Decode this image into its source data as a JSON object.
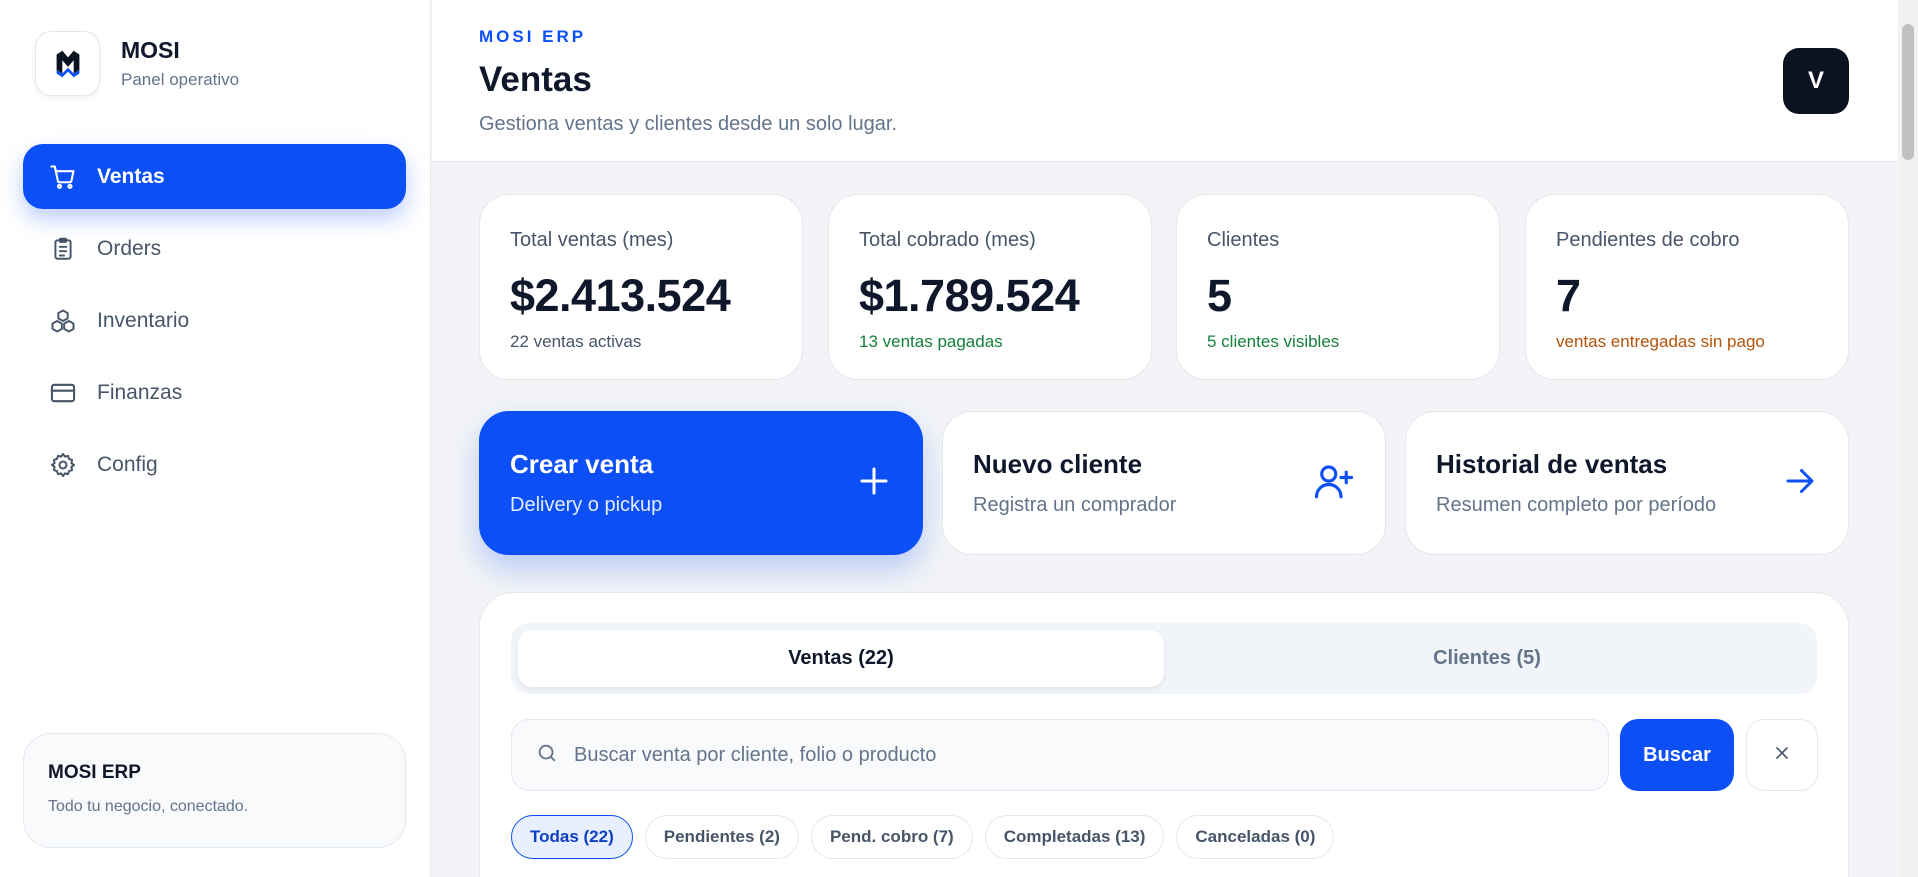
{
  "brand": {
    "name": "MOSI",
    "subtitle": "Panel operativo"
  },
  "nav": [
    {
      "label": "Ventas",
      "icon": "cart-icon",
      "active": true
    },
    {
      "label": "Orders",
      "icon": "clipboard-icon"
    },
    {
      "label": "Inventario",
      "icon": "boxes-icon"
    },
    {
      "label": "Finanzas",
      "icon": "credit-card-icon"
    },
    {
      "label": "Config",
      "icon": "gear-icon"
    }
  ],
  "sidebar_card": {
    "title": "MOSI ERP",
    "subtitle": "Todo tu negocio, conectado."
  },
  "header": {
    "eyebrow": "MOSI ERP",
    "title": "Ventas",
    "subtitle": "Gestiona ventas y clientes desde un solo lugar.",
    "avatar": "V"
  },
  "stats": [
    {
      "label": "Total ventas (mes)",
      "value": "$2.413.524",
      "note": "22 ventas activas",
      "note_color": "#475569"
    },
    {
      "label": "Total cobrado (mes)",
      "value": "$1.789.524",
      "note": "13 ventas pagadas",
      "note_color": "#15803d"
    },
    {
      "label": "Clientes",
      "value": "5",
      "note": "5 clientes visibles",
      "note_color": "#15803d"
    },
    {
      "label": "Pendientes de cobro",
      "value": "7",
      "note": "ventas entregadas sin pago",
      "note_color": "#b45309"
    }
  ],
  "actions": [
    {
      "title": "Crear venta",
      "subtitle": "Delivery o pickup",
      "icon": "plus-icon"
    },
    {
      "title": "Nuevo cliente",
      "subtitle": "Registra un comprador",
      "icon": "user-plus-icon"
    },
    {
      "title": "Historial de ventas",
      "subtitle": "Resumen completo por período",
      "icon": "arrow-right-icon"
    }
  ],
  "tabs": [
    {
      "label": "Ventas (22)",
      "active": true
    },
    {
      "label": "Clientes (5)",
      "active": false
    }
  ],
  "search": {
    "placeholder": "Buscar venta por cliente, folio o producto",
    "value": "",
    "button": "Buscar"
  },
  "filters": [
    {
      "label": "Todas (22)",
      "active": true
    },
    {
      "label": "Pendientes (2)"
    },
    {
      "label": "Pend. cobro (7)"
    },
    {
      "label": "Completadas (13)"
    },
    {
      "label": "Canceladas (0)"
    }
  ],
  "colors": {
    "accent": "#0d4ff7",
    "success": "#15803d",
    "warning": "#b45309"
  }
}
